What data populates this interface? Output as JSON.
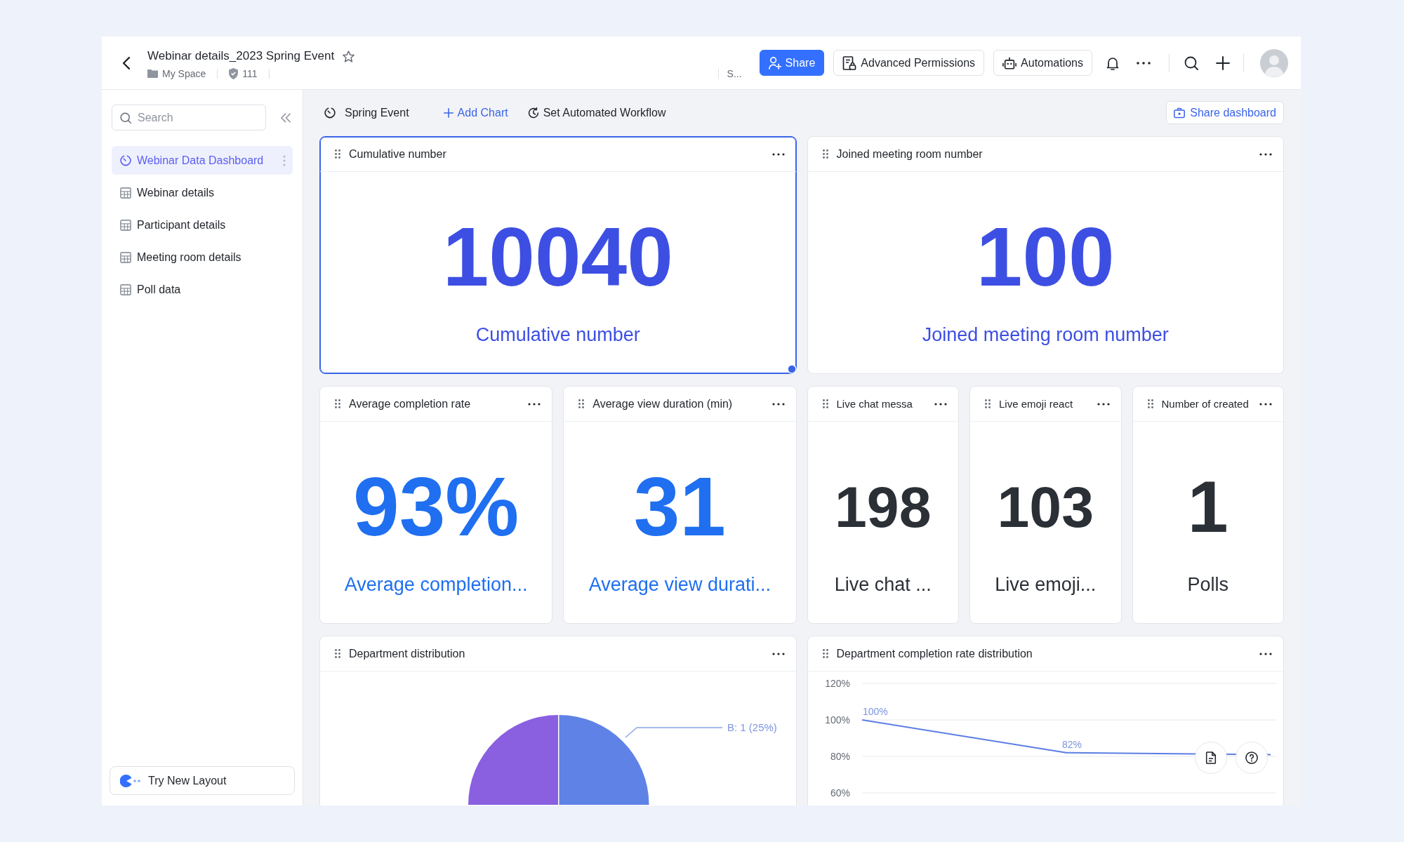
{
  "header": {
    "title": "Webinar details_2023 Spring Event",
    "starred": false,
    "location": "My Space",
    "count": "111",
    "status": "S...",
    "buttons": [
      {
        "kind": "primary",
        "label": "Share"
      },
      {
        "kind": "outline",
        "label": "Advanced Permissions"
      },
      {
        "kind": "outline",
        "label": "Automations"
      }
    ]
  },
  "sidebar": {
    "search": {
      "placeholder": "Search"
    },
    "items": [
      {
        "kind": "dashboard",
        "label": "Webinar Data Dashboard",
        "selected": true
      },
      {
        "kind": "table",
        "label": "Webinar details",
        "selected": false
      },
      {
        "kind": "table",
        "label": "Participant details",
        "selected": false
      },
      {
        "kind": "table",
        "label": "Meeting room details",
        "selected": false
      },
      {
        "kind": "table",
        "label": "Poll data",
        "selected": false
      }
    ],
    "footer_button": "Try New Layout"
  },
  "dashboard": {
    "name": "Spring Event",
    "actions": [
      {
        "kind": "add",
        "label": "Add Chart"
      },
      {
        "kind": "workflow",
        "label": "Set Automated Workflow"
      }
    ],
    "share_button": "Share dashboard",
    "rows": [
      {
        "cards": [
          {
            "kind": "metric",
            "title": "Cumulative number",
            "value": "10040",
            "label": "Cumulative number",
            "color": "#3d4fe3",
            "selected": true
          },
          {
            "kind": "metric",
            "title": "Joined meeting room number",
            "value": "100",
            "label": "Joined meeting room number",
            "color": "#3d4fe3",
            "selected": false
          }
        ]
      },
      {
        "cards": [
          {
            "kind": "metric",
            "title": "Average completion rate",
            "value": "93%",
            "label": "Average completion...",
            "color": "#1f6ff0",
            "selected": false
          },
          {
            "kind": "metric",
            "title": "Average view duration (min)",
            "value": "31",
            "label": "Average view durati...",
            "color": "#1f6ff0",
            "selected": false
          },
          {
            "kind": "metric",
            "title": "Live chat messa",
            "value": "198",
            "label": "Live chat ...",
            "color": "#2b2f36",
            "selected": false
          },
          {
            "kind": "metric",
            "title": "Live emoji react",
            "value": "103",
            "label": "Live emoji...",
            "color": "#2b2f36",
            "selected": false
          },
          {
            "kind": "metric",
            "title": "Number of created",
            "value": "1",
            "label": "Polls",
            "color": "#2b2f36",
            "selected": false
          }
        ]
      },
      {
        "cards": [
          {
            "kind": "pie",
            "title": "Department distribution",
            "slice_label": "B: 1 (25%)",
            "selected": false
          },
          {
            "kind": "line",
            "title": "Department completion rate distribution",
            "selected": false,
            "chart_data": {
              "type": "line",
              "ylim": [
                60,
                120
              ],
              "yticks": [
                {
                  "value": 120,
                  "label": "120%"
                },
                {
                  "value": 100,
                  "label": "100%"
                },
                {
                  "value": 80,
                  "label": "80%"
                },
                {
                  "value": 60,
                  "label": "60%"
                }
              ],
              "series": [
                {
                  "color": "#5b7ee3",
                  "values": [
                    100,
                    82,
                    81
                  ]
                }
              ],
              "value_labels": [
                "100%",
                "82%",
                null
              ]
            }
          }
        ]
      }
    ]
  }
}
